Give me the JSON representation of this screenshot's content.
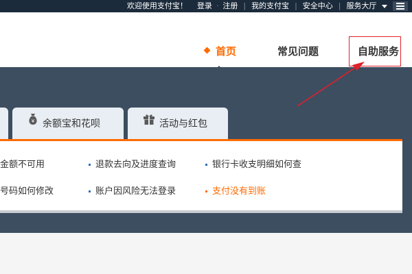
{
  "topbar": {
    "welcome": "欢迎使用支付宝！",
    "login": "登录",
    "separator_dot": "·",
    "register": "注册",
    "separator_bar": "|",
    "my_alipay": "我的支付宝",
    "security_center": "安全中心",
    "service_hall": "服务大厅"
  },
  "nav": {
    "home": "首页",
    "faq": "常见问题",
    "self_service": "自助服务"
  },
  "tabs": [
    {
      "label": ""
    },
    {
      "label": "余额宝和花呗",
      "icon": "money-bag-icon"
    },
    {
      "label": "活动与红包",
      "icon": "gift-icon"
    }
  ],
  "links": {
    "row1": [
      "金额不可用",
      "退款去向及进度查询",
      "银行卡收支明细如何查"
    ],
    "row2": [
      "号码如何修改",
      "账户因风险无法登录",
      "支付没有到账"
    ]
  },
  "colors": {
    "accent": "#ff6a00",
    "topbar": "#1c2b3b",
    "band": "#3d4e60",
    "annotation": "#e0202a"
  }
}
